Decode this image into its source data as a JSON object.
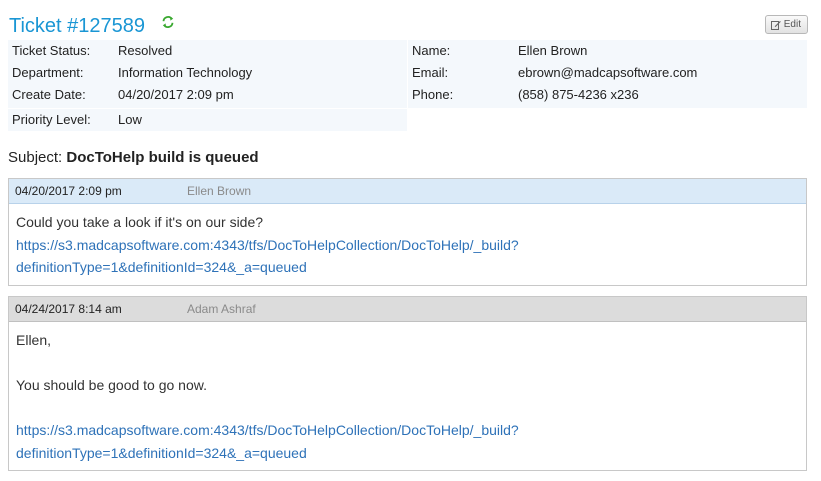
{
  "header": {
    "title": "Ticket #127589",
    "refresh_icon": "refresh-icon",
    "edit_label": "Edit",
    "edit_icon": "edit-icon"
  },
  "info_left": [
    {
      "label": "Ticket Status:",
      "value": "Resolved"
    },
    {
      "label": "Department:",
      "value": "Information Technology"
    },
    {
      "label": "Create Date:",
      "value": "04/20/2017 2:09 pm"
    },
    {
      "label": "Priority Level:",
      "value": "Low"
    }
  ],
  "info_right": [
    {
      "label": "Name:",
      "value": "Ellen Brown"
    },
    {
      "label": "Email:",
      "value": "ebrown@madcapsoftware.com"
    },
    {
      "label": "Phone:",
      "value": "(858) 875-4236 x236"
    }
  ],
  "subject": {
    "label": "Subject:",
    "text": "DocToHelp build is queued"
  },
  "messages": [
    {
      "date": "04/20/2017 2:09 pm",
      "author": "Ellen Brown",
      "lines": [
        {
          "text": "Could you take a look if it's on our side?",
          "link": false
        },
        {
          "text": "https://s3.madcapsoftware.com:4343/tfs/DocToHelpCollection/DocToHelp/_build?",
          "link": true
        },
        {
          "text": "definitionType=1&definitionId=324&_a=queued",
          "link": true
        }
      ]
    },
    {
      "date": "04/24/2017 8:14 am",
      "author": "Adam Ashraf",
      "lines": [
        {
          "text": "Ellen,",
          "link": false
        },
        {
          "text": "",
          "link": false
        },
        {
          "text": "You should be good to go now.",
          "link": false
        },
        {
          "text": "",
          "link": false
        },
        {
          "text": "https://s3.madcapsoftware.com:4343/tfs/DocToHelpCollection/DocToHelp/_build?",
          "link": true
        },
        {
          "text": "definitionType=1&definitionId=324&_a=queued",
          "link": true
        }
      ]
    }
  ],
  "colors": {
    "title": "#1a96d4",
    "link": "#2e72b8",
    "info_bg": "#f4f8fc",
    "msg1_header_bg": "#daeaf8",
    "msg2_header_bg": "#dcdcdc",
    "refresh_icon": "#3aa830"
  }
}
